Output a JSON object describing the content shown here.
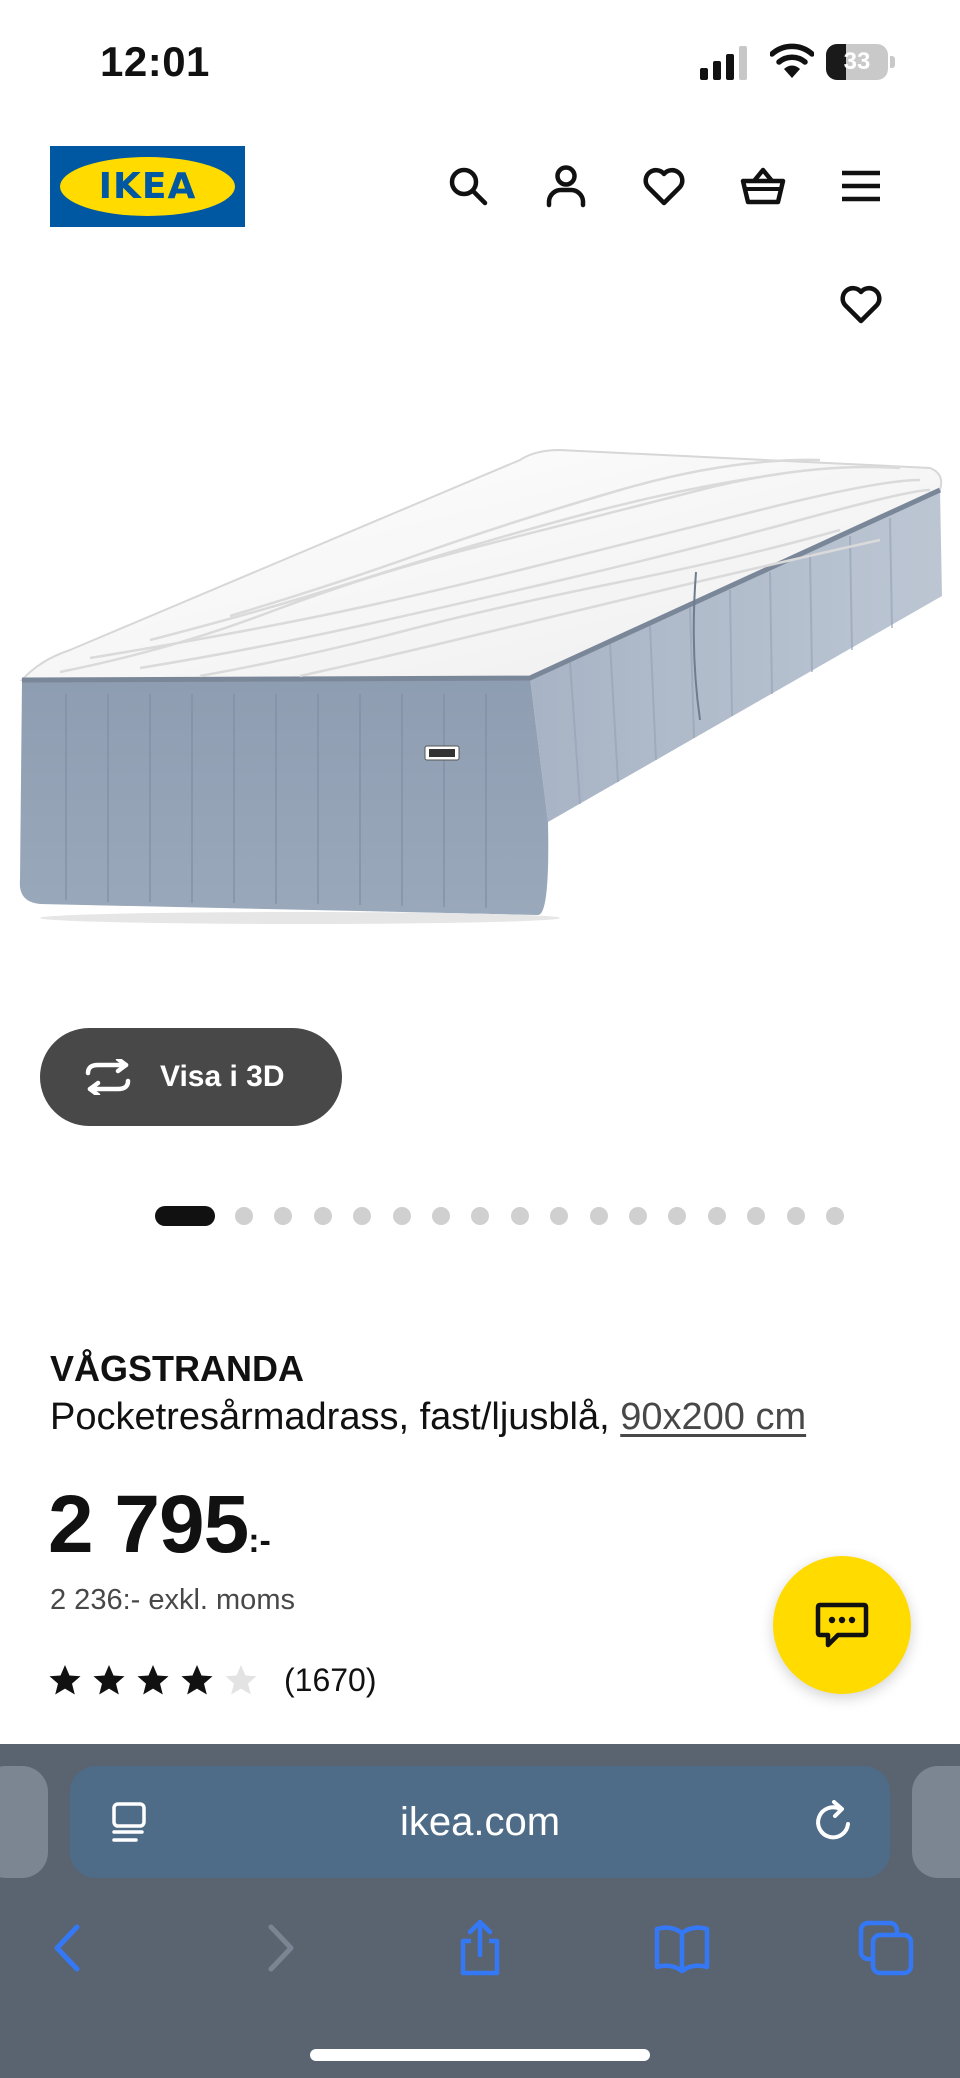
{
  "status_bar": {
    "time": "12:01",
    "battery_level": "33"
  },
  "header": {
    "logo_text": "IKEA",
    "icons": [
      "search-icon",
      "account-icon",
      "favorites-icon",
      "basket-icon",
      "menu-icon"
    ]
  },
  "product": {
    "name": "VÅGSTRANDA",
    "description": "Pocketresårmadrass, fast/ljusblå, ",
    "size": "90x200 cm",
    "price": "2 795",
    "price_suffix": ":-",
    "price_excl_vat": "2 236:- exkl. moms",
    "rating": 4,
    "rating_max": 5,
    "review_count": "(1670)"
  },
  "gallery": {
    "view_3d_label": "Visa i 3D",
    "image_count": 17,
    "active_index": 0
  },
  "colors": {
    "ikea_blue": "#0058a3",
    "ikea_yellow": "#ffdb00",
    "safari_blue": "#3478f6",
    "pill_dark": "#484848"
  },
  "browser": {
    "url": "ikea.com"
  }
}
